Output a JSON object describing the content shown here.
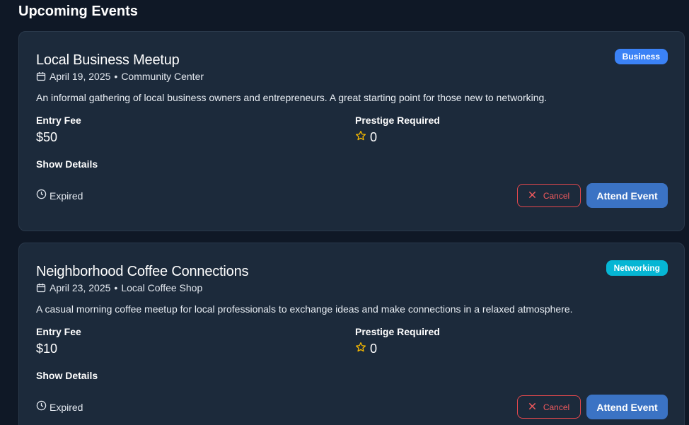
{
  "page": {
    "title": "Upcoming Events"
  },
  "events": [
    {
      "title": "Local Business Meetup",
      "category": "Business",
      "date": "April 19, 2025",
      "separator": "•",
      "location": "Community Center",
      "description": "An informal gathering of local business owners and entrepreneurs. A great starting point for those new to networking.",
      "entry_fee_label": "Entry Fee",
      "entry_fee": "$50",
      "prestige_label": "Prestige Required",
      "prestige": "0",
      "show_details": "Show Details",
      "status": "Expired",
      "cancel_label": "Cancel",
      "attend_label": "Attend Event"
    },
    {
      "title": "Neighborhood Coffee Connections",
      "category": "Networking",
      "date": "April 23, 2025",
      "separator": "•",
      "location": "Local Coffee Shop",
      "description": "A casual morning coffee meetup for local professionals to exchange ideas and make connections in a relaxed atmosphere.",
      "entry_fee_label": "Entry Fee",
      "entry_fee": "$10",
      "prestige_label": "Prestige Required",
      "prestige": "0",
      "show_details": "Show Details",
      "status": "Expired",
      "cancel_label": "Cancel",
      "attend_label": "Attend Event"
    }
  ],
  "colors": {
    "background": "#0f1826",
    "card": "#1c2a3b",
    "business_badge": "#3b82f6",
    "networking_badge": "#06b6d4",
    "cancel": "#e5484d",
    "attend": "#3b73c4",
    "star": "#f5b800"
  },
  "icons": {
    "date": "calendar-icon",
    "prestige": "star-icon",
    "status": "clock-icon",
    "cancel": "x-icon"
  }
}
